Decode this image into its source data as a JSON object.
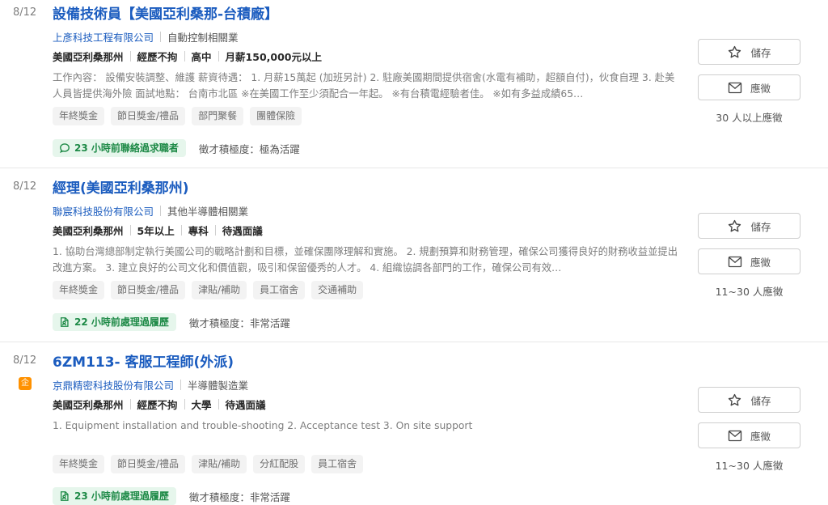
{
  "jobs": [
    {
      "date": "8/12",
      "enterprise_badge": "",
      "title": "設備技術員【美國亞利桑那-台積廠】",
      "company": "上彥科技工程有限公司",
      "industry": "自動控制相關業",
      "meta": [
        "美國亞利桑那州",
        "經歷不拘",
        "高中",
        "月薪150,000元以上"
      ],
      "description": "工作內容： 設備安裝調整、維護 薪資待遇： 1. 月薪15萬起 (加班另計) 2. 駐廠美國期間提供宿舍(水電有補助，超額自付)，伙食自理 3. 赴美人員皆提供海外險 面試地點： 台南市北區 ※在美國工作至少須配合一年起。 ※有台積電經驗者佳。 ※如有多益成績65…",
      "tags": [
        "年終獎金",
        "節日獎金/禮品",
        "部門聚餐",
        "團體保險"
      ],
      "contact_icon": "chat-icon",
      "contact": "23 小時前聯絡過求職者",
      "activity": "徵才積極度：極為活躍",
      "save_label": "儲存",
      "apply_label": "應徵",
      "applicants": "30 人以上應徵"
    },
    {
      "date": "8/12",
      "enterprise_badge": "",
      "title": "經理(美國亞利桑那州)",
      "company": "聯宸科技股份有限公司",
      "industry": "其他半導體相關業",
      "meta": [
        "美國亞利桑那州",
        "5年以上",
        "專科",
        "待遇面議"
      ],
      "description": "1. 協助台灣總部制定執行美國公司的戰略計劃和目標，並確保團隊理解和實施。 2. 規劃預算和財務管理，確保公司獲得良好的財務收益並提出改進方案。 3. 建立良好的公司文化和價值觀，吸引和保留優秀的人才。 4. 組織協調各部門的工作，確保公司有效…",
      "tags": [
        "年終獎金",
        "節日獎金/禮品",
        "津貼/補助",
        "員工宿舍",
        "交通補助"
      ],
      "contact_icon": "resume-icon",
      "contact": "22 小時前處理過履歷",
      "activity": "徵才積極度：非常活躍",
      "save_label": "儲存",
      "apply_label": "應徵",
      "applicants": "11~30 人應徵"
    },
    {
      "date": "8/12",
      "enterprise_badge": "企",
      "title": "6ZM113- 客服工程師(外派)",
      "company": "京鼎精密科技股份有限公司",
      "industry": "半導體製造業",
      "meta": [
        "美國亞利桑那州",
        "經歷不拘",
        "大學",
        "待遇面議"
      ],
      "description": "1. Equipment installation and trouble-shooting 2. Acceptance test 3. On site support",
      "tags": [
        "年終獎金",
        "節日獎金/禮品",
        "津貼/補助",
        "分紅配股",
        "員工宿舍"
      ],
      "contact_icon": "resume-icon",
      "contact": "23 小時前處理過履歷",
      "activity": "徵才積極度：非常活躍",
      "save_label": "儲存",
      "apply_label": "應徵",
      "applicants": "11~30 人應徵"
    }
  ],
  "colors": {
    "title": "#1b5cbf",
    "contact_bg": "#e6f6ec",
    "contact_text": "#1e8a47",
    "badge": "#ff9100"
  }
}
